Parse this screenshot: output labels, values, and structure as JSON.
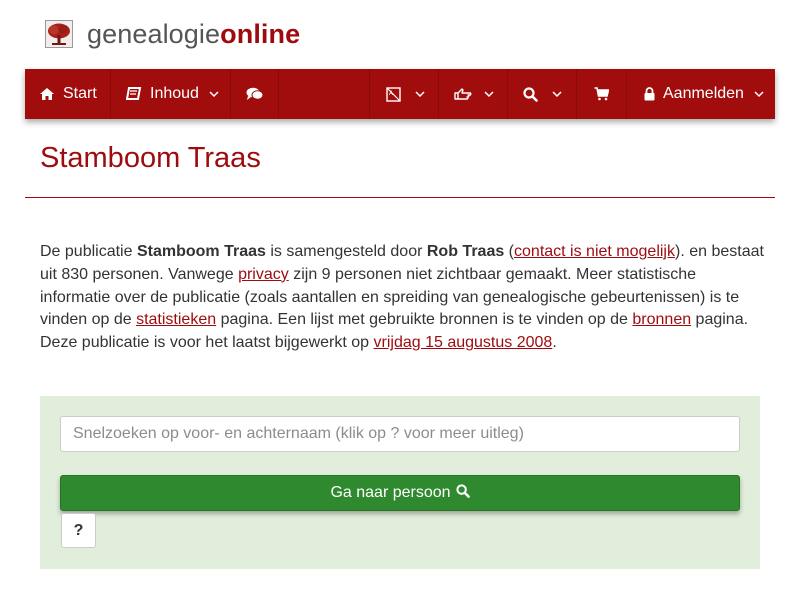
{
  "header": {
    "logo_icon": "tree-logo-icon",
    "logo_part1": "genealogie",
    "logo_part2": "online"
  },
  "nav": {
    "start_label": "Start",
    "inhoud_label": "Inhoud",
    "login_label": "Aanmelden",
    "icons": {
      "start": "home-icon",
      "inhoud": "book-icon",
      "chat": "comments-icon",
      "language": "language-icon",
      "hand": "hand-pointer-icon",
      "search": "search-icon",
      "cart": "cart-icon",
      "lock": "lock-icon",
      "caret": "chevron-down-icon"
    }
  },
  "page": {
    "title": "Stamboom Traas"
  },
  "intro": {
    "t1": "De publicatie ",
    "pub_name": "Stamboom Traas",
    "t2": " is samengesteld door ",
    "author": "Rob Traas",
    "t3": " (",
    "contact_link": "contact is niet mogelijk",
    "t4": "). en bestaat uit 830 personen. Vanwege ",
    "privacy_link": "privacy",
    "t5": " zijn 9 personen niet zichtbaar gemaakt. Meer statistische informatie over de publicatie (zoals aantallen en spreiding van genealogische gebeurtenissen) is te vinden op de ",
    "stats_link": "statistieken",
    "t6": " pagina. Een lijst met gebruikte bronnen is te vinden op de ",
    "sources_link": "bronnen",
    "t7": " pagina. Deze publicatie is voor het laatst bijgewerkt op ",
    "date_link": "vrijdag 15 augustus 2008",
    "t8": "."
  },
  "search": {
    "placeholder": "Snelzoeken op voor- en achternaam (klik op ? voor meer uitleg)",
    "value": "",
    "go_label": "Ga naar persoon",
    "help_label": "?"
  },
  "colors": {
    "brand": "#9e0b0f",
    "navbar": "#a10d0d",
    "panel": "#e2eedc",
    "button_green": "#2f8a2f"
  }
}
